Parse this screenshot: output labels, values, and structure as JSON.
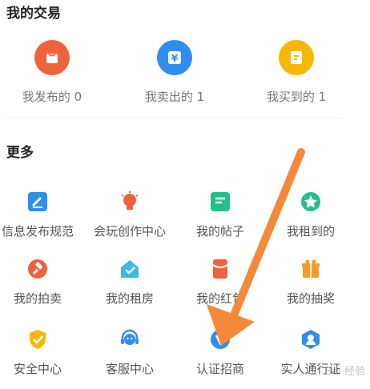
{
  "sections": {
    "trade_title": "我的交易",
    "more_title": "更多"
  },
  "trade": [
    {
      "label": "我发布的 0",
      "icon": "bag-icon",
      "color": "#F0623C"
    },
    {
      "label": "我卖出的 1",
      "icon": "yen-icon",
      "color": "#2E8FF0"
    },
    {
      "label": "我买到的 1",
      "icon": "receipt-icon",
      "color": "#F5B800"
    }
  ],
  "more": [
    {
      "label": "信息发布规范",
      "icon": "edit-icon",
      "color": "#2E8FF0"
    },
    {
      "label": "会玩创作中心",
      "icon": "lightbulb-icon",
      "color": "#F0623C"
    },
    {
      "label": "我的帖子",
      "icon": "post-icon",
      "color": "#22C08A"
    },
    {
      "label": "我租到的",
      "icon": "star-icon",
      "color": "#22C08A"
    },
    {
      "label": "我的拍卖",
      "icon": "gavel-icon",
      "color": "#F0623C"
    },
    {
      "label": "我的租房",
      "icon": "house-icon",
      "color": "#3DB7E8"
    },
    {
      "label": "我的红包",
      "icon": "redpacket-icon",
      "color": "#F0623C"
    },
    {
      "label": "我的抽奖",
      "icon": "gift-icon",
      "color": "#F79A2A"
    },
    {
      "label": "安全中心",
      "icon": "shield-icon",
      "color": "#F5B800"
    },
    {
      "label": "客服中心",
      "icon": "headset-icon",
      "color": "#2E8FF0"
    },
    {
      "label": "认证招商",
      "icon": "verified-icon",
      "color": "#2E8FF0"
    },
    {
      "label": "实人通行证",
      "icon": "person-badge-icon",
      "color": "#2E8FF0"
    }
  ],
  "arrow_color": "#F5893A",
  "watermark": "Bai 经验"
}
